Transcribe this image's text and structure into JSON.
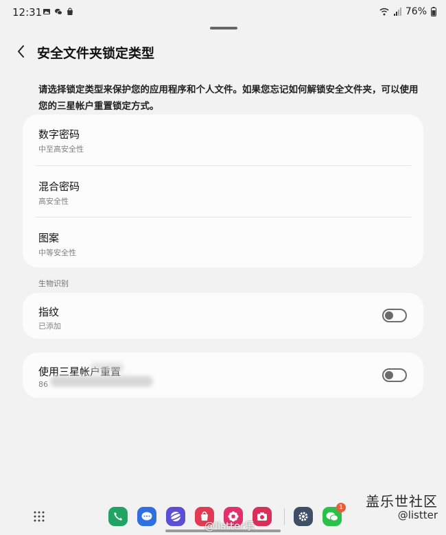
{
  "status_bar": {
    "time": "12:31",
    "battery": "76%"
  },
  "header": {
    "title": "安全文件夹锁定类型"
  },
  "description": "请选择锁定类型来保护您的应用程序和个人文件。如果您忘记如何解锁安全文件夹，可以使用您的三星帐户重置锁定方式。",
  "lock_types": [
    {
      "title": "数字密码",
      "subtitle": "中至高安全性"
    },
    {
      "title": "混合密码",
      "subtitle": "高安全性"
    },
    {
      "title": "图案",
      "subtitle": "中等安全性"
    }
  ],
  "biometrics": {
    "section_label": "生物识别",
    "fingerprint": {
      "title": "指纹",
      "subtitle": "已添加",
      "enabled": false
    }
  },
  "samsung_reset": {
    "title": "使用三星帐户重置",
    "subtitle": "86",
    "enabled": false
  },
  "watermark": {
    "brand": "盖乐世社区",
    "user": "@listter",
    "center": "@listter乐"
  },
  "dock": {
    "apps": [
      {
        "icon": "phone-icon",
        "color": "#1fa463"
      },
      {
        "icon": "messages-icon",
        "color": "#2f6fe0"
      },
      {
        "icon": "internet-icon",
        "color": "#5b4fd6"
      },
      {
        "icon": "galaxy-store-icon",
        "color": "#e23a52"
      },
      {
        "icon": "bixby-icon",
        "color": "#e1306c"
      },
      {
        "icon": "camera-icon",
        "color": "#d9305b"
      }
    ],
    "recent_apps": [
      {
        "icon": "settings-icon",
        "color": "#3f4f66"
      },
      {
        "icon": "wechat-icon",
        "color": "#2bc04c",
        "badge": "1"
      }
    ]
  },
  "colors": {
    "background": "#f2f2f2",
    "card": "#fcfcfc",
    "toggle": "#6b6b6b"
  }
}
